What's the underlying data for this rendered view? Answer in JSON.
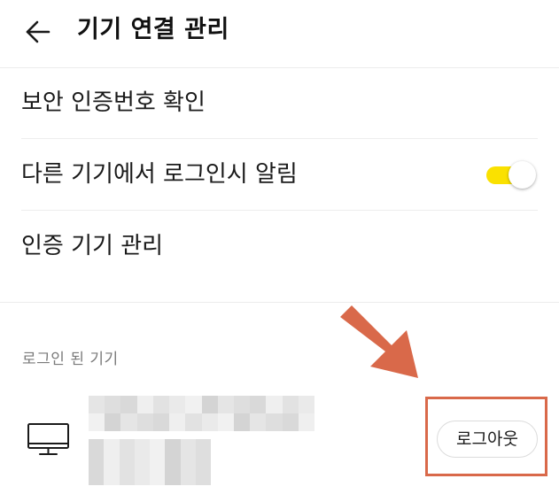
{
  "header": {
    "title": "기기 연결 관리",
    "back_icon": "arrow-left-icon"
  },
  "menu": {
    "items": [
      {
        "label": "보안 인증번호 확인"
      },
      {
        "label": "다른 기기에서 로그인시 알림",
        "toggle_on": true
      },
      {
        "label": "인증 기기 관리"
      }
    ]
  },
  "logged_in_section": {
    "label": "로그인 된 기기",
    "device": {
      "icon": "monitor-icon",
      "name_redacted": true,
      "info_redacted": true,
      "logout_label": "로그아웃"
    }
  },
  "colors": {
    "toggle_on": "#fae100",
    "annotation": "#d9694a",
    "divider": "#ececec",
    "section_label": "#7a7a7a"
  }
}
